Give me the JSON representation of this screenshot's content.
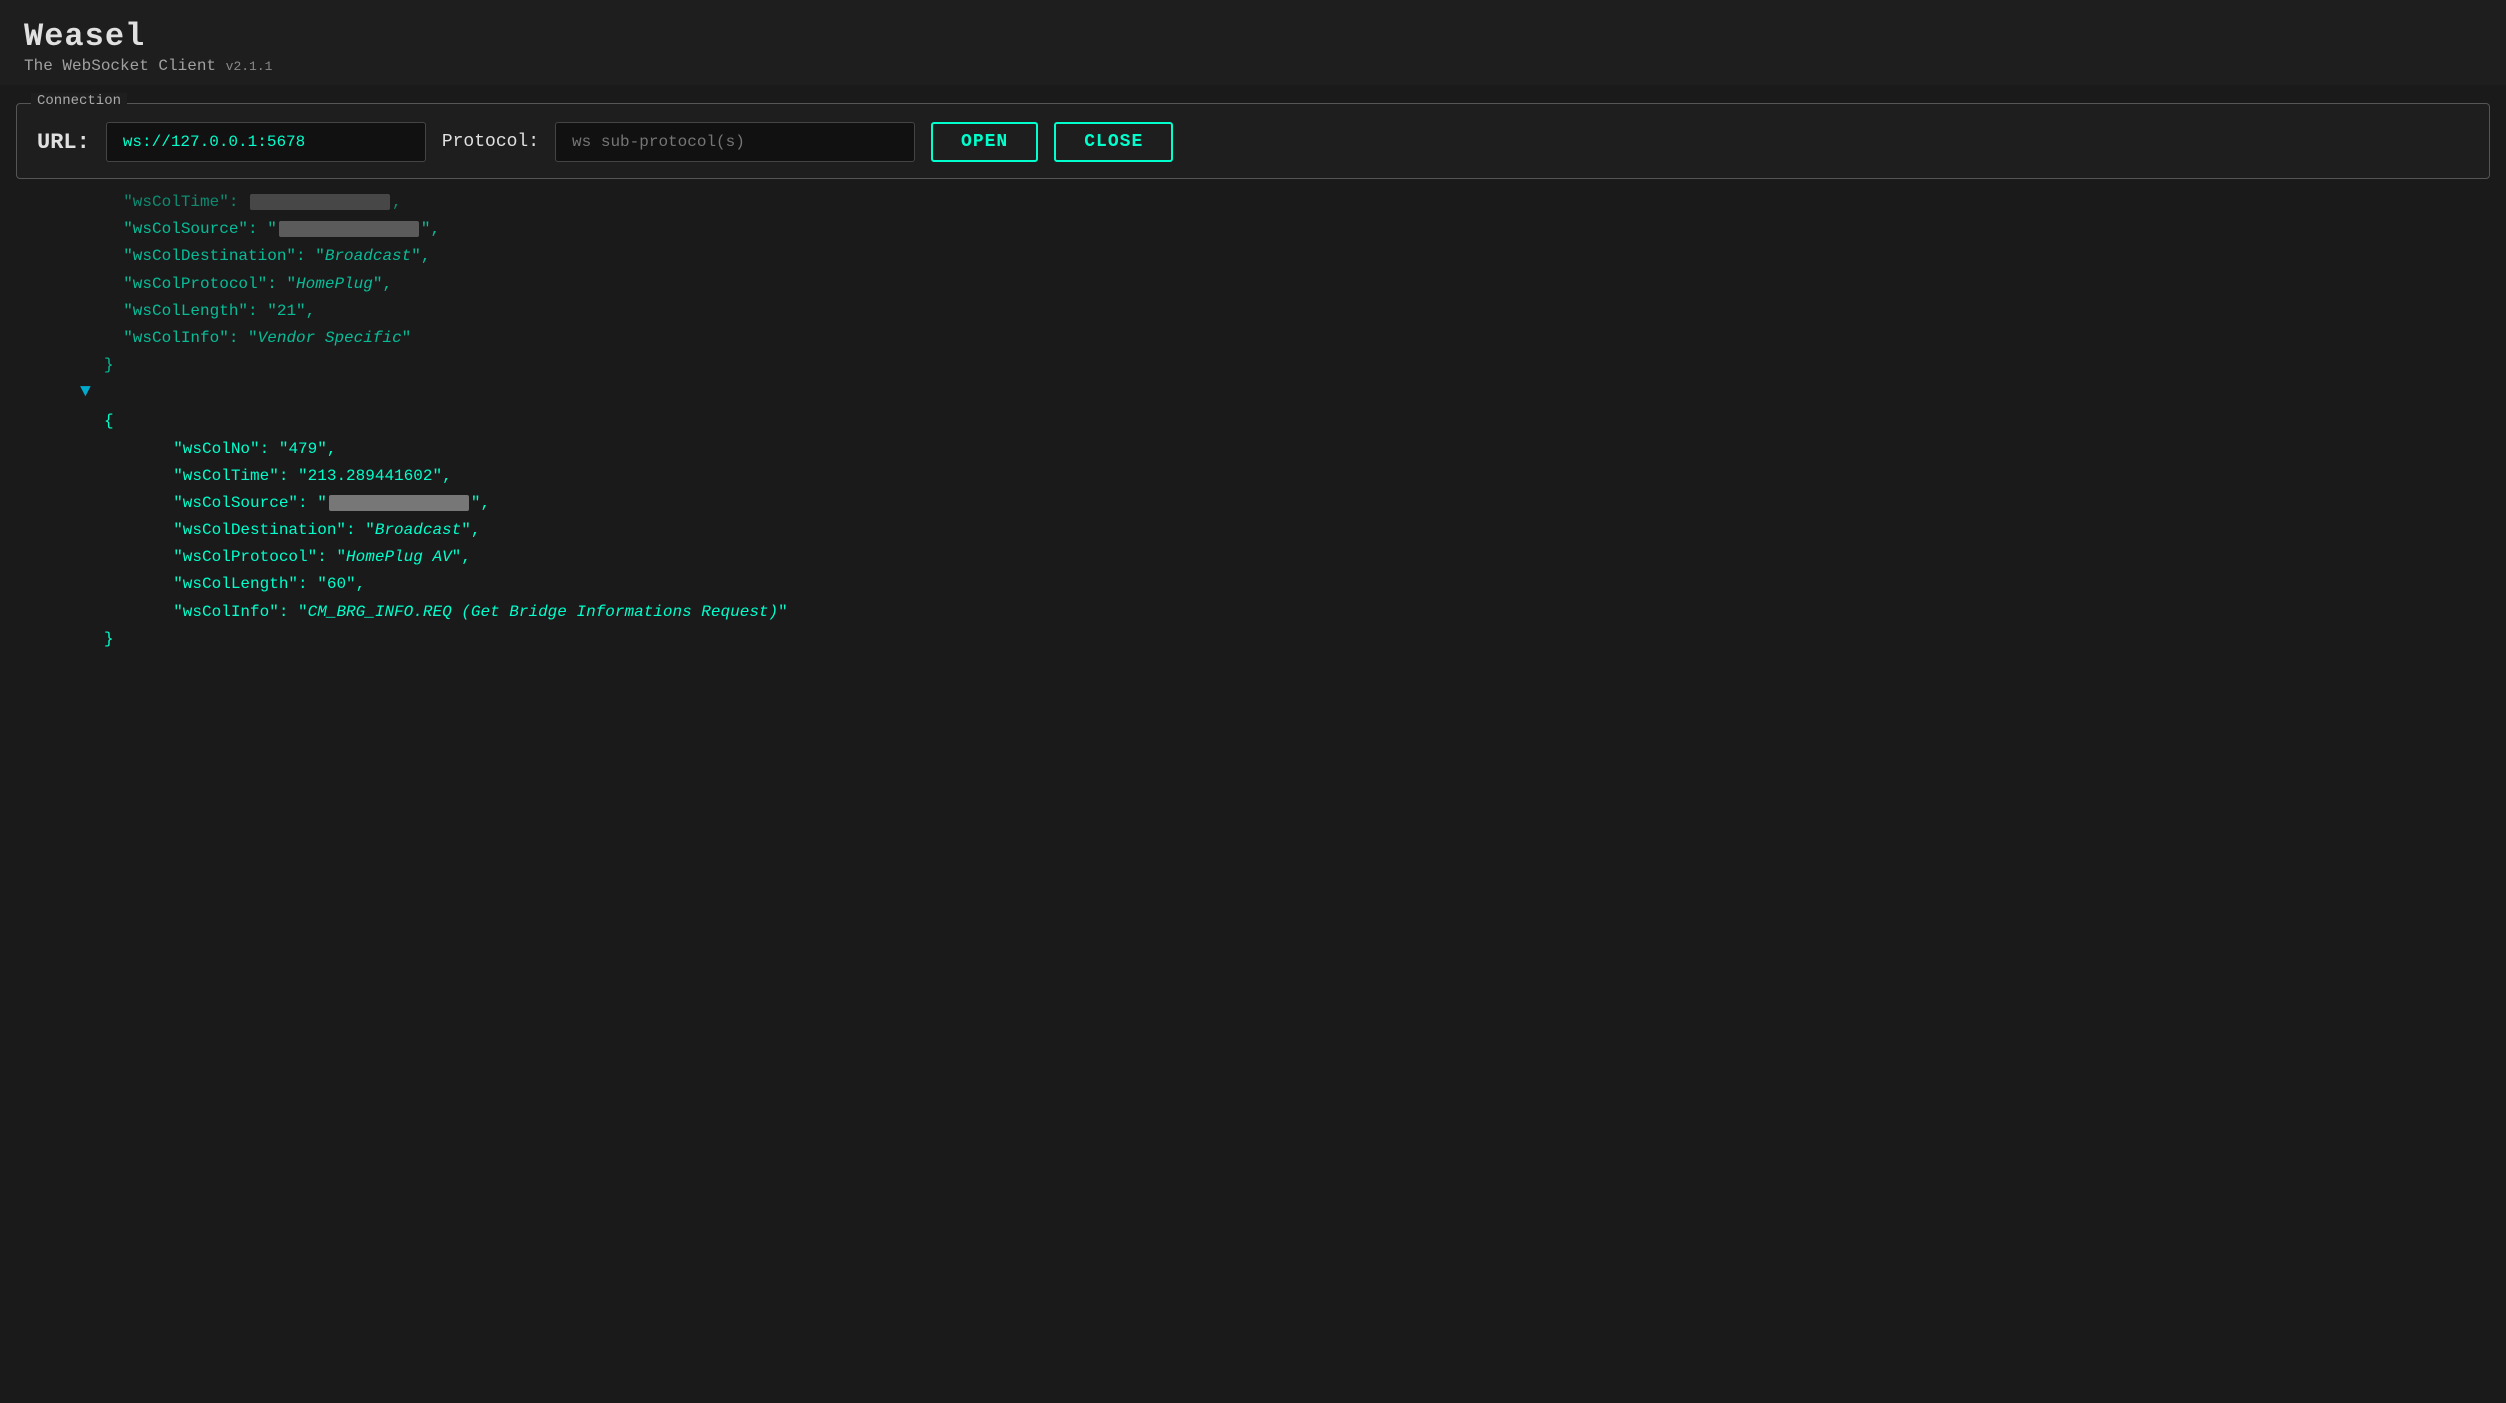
{
  "app": {
    "title": "Weasel",
    "subtitle": "The WebSocket Client",
    "version": "v2.1.1"
  },
  "connection": {
    "label": "Connection",
    "url_label": "URL:",
    "url_value": "ws://127.0.0.1:5678",
    "protocol_label": "Protocol:",
    "protocol_placeholder": "ws sub-protocol(s)",
    "btn_open": "OPEN",
    "btn_close": "CLOSE"
  },
  "messages": {
    "block1": {
      "partial_key": "wsColTime",
      "wsColSource_redacted": true,
      "wsColDestination": "Broadcast",
      "wsColProtocol": "HomePlug",
      "wsColLength": "21",
      "wsColInfo": "Vendor Specific"
    },
    "block2": {
      "wsColNo": "479",
      "wsColTime": "213.289441602",
      "wsColSource_redacted": true,
      "wsColDestination": "Broadcast",
      "wsColProtocol": "HomePlug AV",
      "wsColLength": "60",
      "wsColInfo": "CM_BRG_INFO.REQ (Get Bridge Informations Request)"
    }
  }
}
